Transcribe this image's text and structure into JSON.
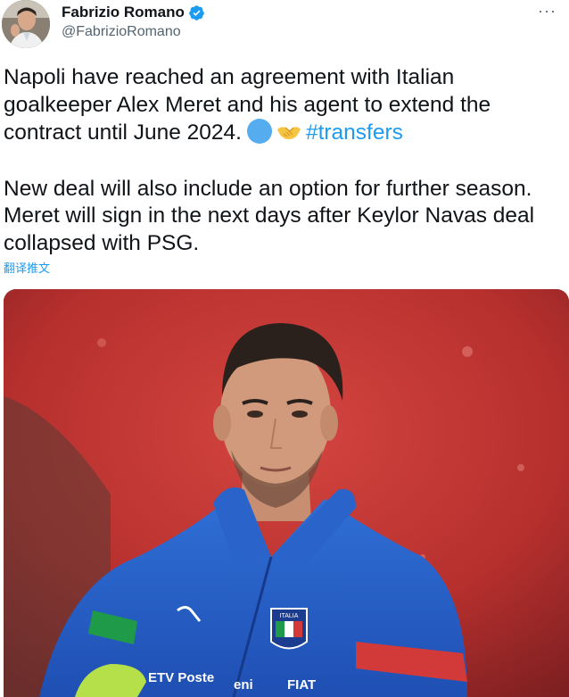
{
  "author": {
    "display_name": "Fabrizio Romano",
    "handle": "@FabrizioRomano",
    "verified_icon": "verified-badge-icon",
    "avatar_icon": "profile-avatar"
  },
  "more_icon": "more-dots-icon",
  "tweet": {
    "paragraph_1_text": "Napoli have reached an agreement with Italian goalkeeper Alex Meret and his agent to extend the contract until June 2024.",
    "paragraph_1_emoji": [
      "blue-circle-emoji",
      "handshake-emoji"
    ],
    "hashtag": "#transfers",
    "paragraph_2_text": "New deal will also include an option for further season. Meret will sign in the next days after Keylor Navas deal collapsed with PSG."
  },
  "translate_label": "翻译推文",
  "photo": {
    "alt": "goalkeeper-photo",
    "jersey_sponsors": [
      "ETV Poste",
      "eni",
      "FIAT"
    ],
    "badge_text": "ITALIA"
  },
  "colors": {
    "link": "#1d9bf0",
    "text": "#0f1419",
    "muted": "#536471",
    "verified": "#1d9bf0"
  }
}
